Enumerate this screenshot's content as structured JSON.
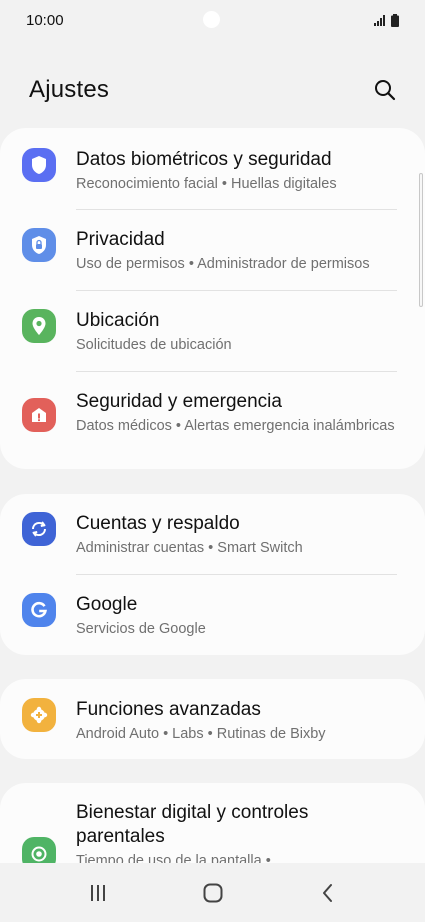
{
  "status": {
    "time": "10:00",
    "icons": [
      "signal-icon",
      "battery-icon"
    ]
  },
  "header": {
    "title": "Ajustes",
    "search_icon": "search-icon"
  },
  "groups": [
    {
      "items": [
        {
          "title": "Datos biométricos y seguridad",
          "subtitle": "Reconocimiento facial  •  Huellas digitales",
          "icon": "shield-icon",
          "color": "#5b6ff2"
        },
        {
          "title": "Privacidad",
          "subtitle": "Uso de permisos  •  Administrador de permisos",
          "icon": "privacy-shield-icon",
          "color": "#5f8ee8"
        },
        {
          "title": "Ubicación",
          "subtitle": "Solicitudes de ubicación",
          "icon": "location-pin-icon",
          "color": "#59b45e"
        },
        {
          "title": "Seguridad y emergencia",
          "subtitle": "Datos médicos  •  Alertas emergencia inalámbricas",
          "icon": "emergency-icon",
          "color": "#e2605a"
        }
      ]
    },
    {
      "items": [
        {
          "title": "Cuentas y respaldo",
          "subtitle": "Administrar cuentas  •  Smart Switch",
          "icon": "sync-icon",
          "color": "#3f64d6"
        },
        {
          "title": "Google",
          "subtitle": "Servicios de Google",
          "icon": "google-icon",
          "color": "#4f84ec"
        }
      ]
    },
    {
      "items": [
        {
          "title": "Funciones avanzadas",
          "subtitle": "Android Auto  •  Labs  •  Rutinas de Bixby",
          "icon": "gear-plus-icon",
          "color": "#f2b23e"
        }
      ]
    },
    {
      "items": [
        {
          "title": "Bienestar digital y controles parentales",
          "subtitle": "Tiempo de uso de la pantalla  •",
          "icon": "wellbeing-icon",
          "color": "#4fb465"
        }
      ]
    }
  ],
  "navbar": {
    "recents_icon": "recents-icon",
    "home_icon": "home-icon",
    "back_icon": "back-icon"
  }
}
